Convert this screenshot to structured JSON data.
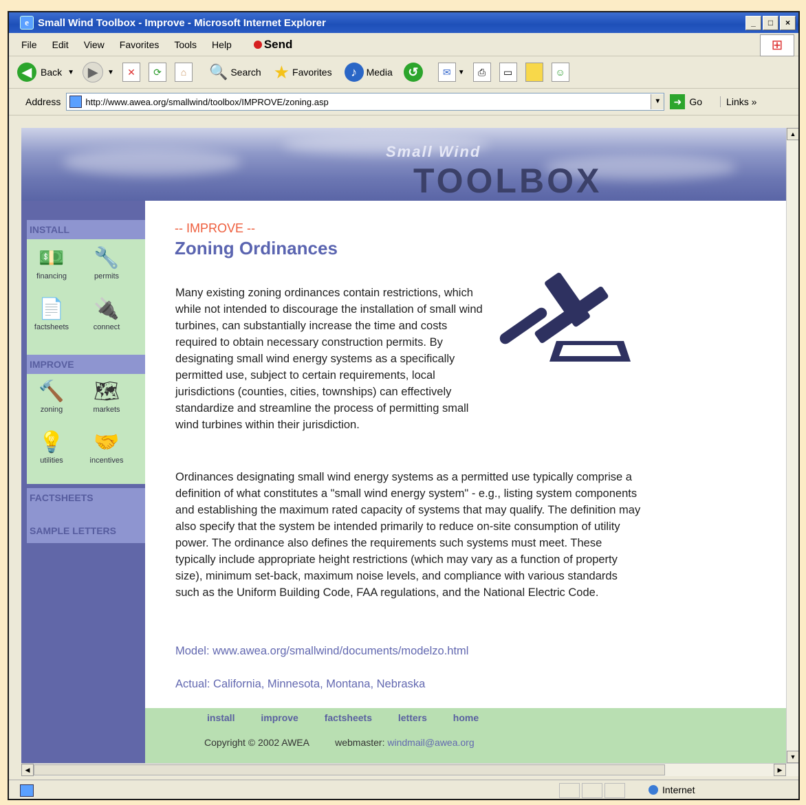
{
  "window": {
    "title": "Small Wind Toolbox - Improve - Microsoft Internet Explorer",
    "buttons": [
      "_",
      "□",
      "×"
    ]
  },
  "menu": [
    "File",
    "Edit",
    "View",
    "Favorites",
    "Tools",
    "Help"
  ],
  "send_label": "Send",
  "toolbar": {
    "back": "Back",
    "search": "Search",
    "favorites": "Favorites",
    "media": "Media"
  },
  "address": {
    "label": "Address",
    "url": "http://www.awea.org/smallwind/toolbox/IMPROVE/zoning.asp",
    "go": "Go",
    "links": "Links »"
  },
  "banner": {
    "small_wind": "Small Wind",
    "toolbox": "TOOLBOX"
  },
  "sidebar": {
    "install_head": "INSTALL",
    "install_items": [
      "financing",
      "permits",
      "factsheets",
      "connect"
    ],
    "improve_head": "IMPROVE",
    "improve_items": [
      "zoning",
      "markets",
      "utilities",
      "incentives"
    ],
    "factsheets": "FACTSHEETS",
    "sample_letters": "SAMPLE LETTERS"
  },
  "main": {
    "kicker": "-- IMPROVE --",
    "title": "Zoning Ordinances",
    "para1": "Many existing zoning ordinances contain restrictions, which while not intended to discourage the installation of small wind turbines, can substantially increase the time and costs required to obtain necessary construction permits. By designating small wind energy systems as a specifically permitted use, subject to certain requirements, local jurisdictions (counties, cities, townships) can effectively standardize and streamline the process of permitting small wind turbines within their jurisdiction.",
    "para2": "Ordinances designating small wind energy systems as a permitted use typically comprise a definition of what constitutes a \"small wind energy system\" - e.g., listing system components and establishing the maximum rated capacity of systems that may qualify. The definition may also specify that the system be intended primarily to reduce on-site consumption of utility power. The ordinance also defines the requirements such systems must meet. These typically include appropriate height restrictions (which may vary as a function of property size), minimum set-back, maximum noise levels, and compliance with various standards such as the Uniform Building Code, FAA regulations, and the National Electric Code.",
    "model_label": "Model:",
    "model_link": "www.awea.org/smallwind/documents/modelzo.html",
    "actual_label": "Actual:",
    "actual_links": [
      "California",
      "Minnesota",
      "Montana",
      "Nebraska"
    ]
  },
  "footer": {
    "nav": [
      "install",
      "improve",
      "factsheets",
      "letters",
      "home"
    ],
    "copyright": "Copyright © 2002 AWEA",
    "webmaster_label": "webmaster:",
    "webmaster_email": "windmail@awea.org"
  },
  "status": {
    "zone": "Internet"
  }
}
